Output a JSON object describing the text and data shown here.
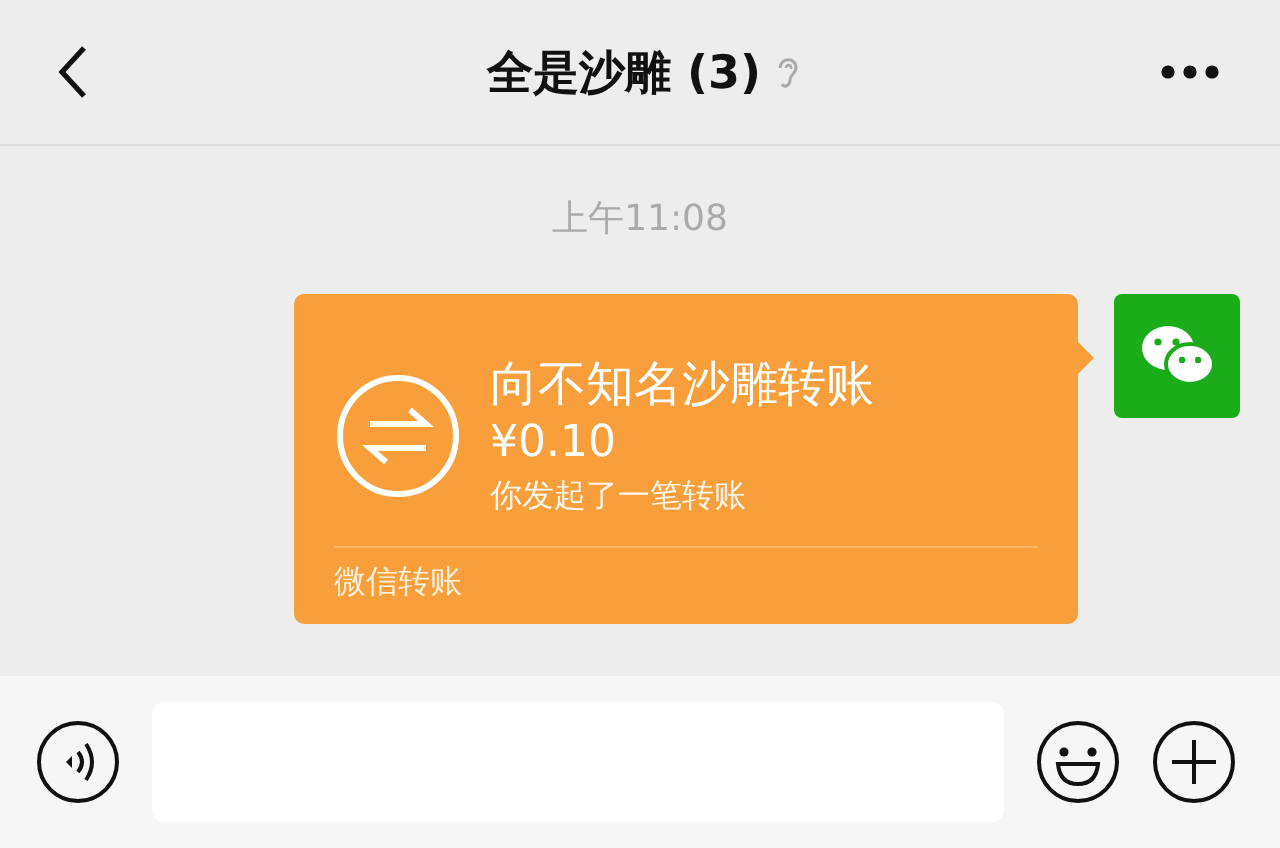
{
  "header": {
    "title": "全是沙雕 (3)"
  },
  "timestamp": "上午11:08",
  "messages": [
    {
      "kind": "transfer",
      "title": "向不知名沙雕转账",
      "amount": "¥0.10",
      "note": "你发起了一笔转账",
      "footer": "微信转账"
    }
  ]
}
